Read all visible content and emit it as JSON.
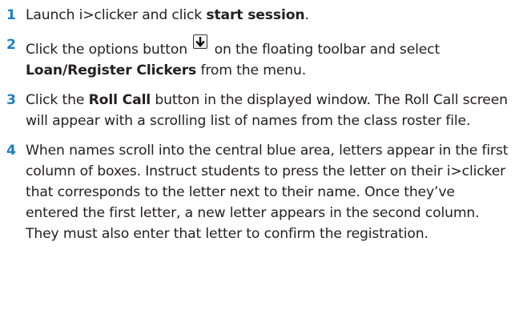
{
  "steps": [
    {
      "number": "1",
      "text_before": "Launch i>clicker and click ",
      "bold": "start session",
      "text_after": "."
    },
    {
      "number": "2",
      "text_before": "Click the options button ",
      "icon": "options-arrow-down-icon",
      "text_mid": " on the floating toolbar and select ",
      "bold": "Loan/Register Clickers",
      "text_after": " from the menu."
    },
    {
      "number": "3",
      "text_before": "Click the ",
      "bold": "Roll Call",
      "text_after": " button in the displayed window. The Roll Call screen will appear with a scrolling list of names from the class roster file."
    },
    {
      "number": "4",
      "text": "When names scroll into the central blue area, letters appear in the first column of boxes. Instruct students to press the letter on their i>clicker that corresponds to the letter next to their name. Once they’ve entered the first letter, a new letter appears in the second column. They must also enter that letter to confirm the registration."
    }
  ],
  "colors": {
    "step_number": "#1e7fc6",
    "text": "#231f20"
  }
}
